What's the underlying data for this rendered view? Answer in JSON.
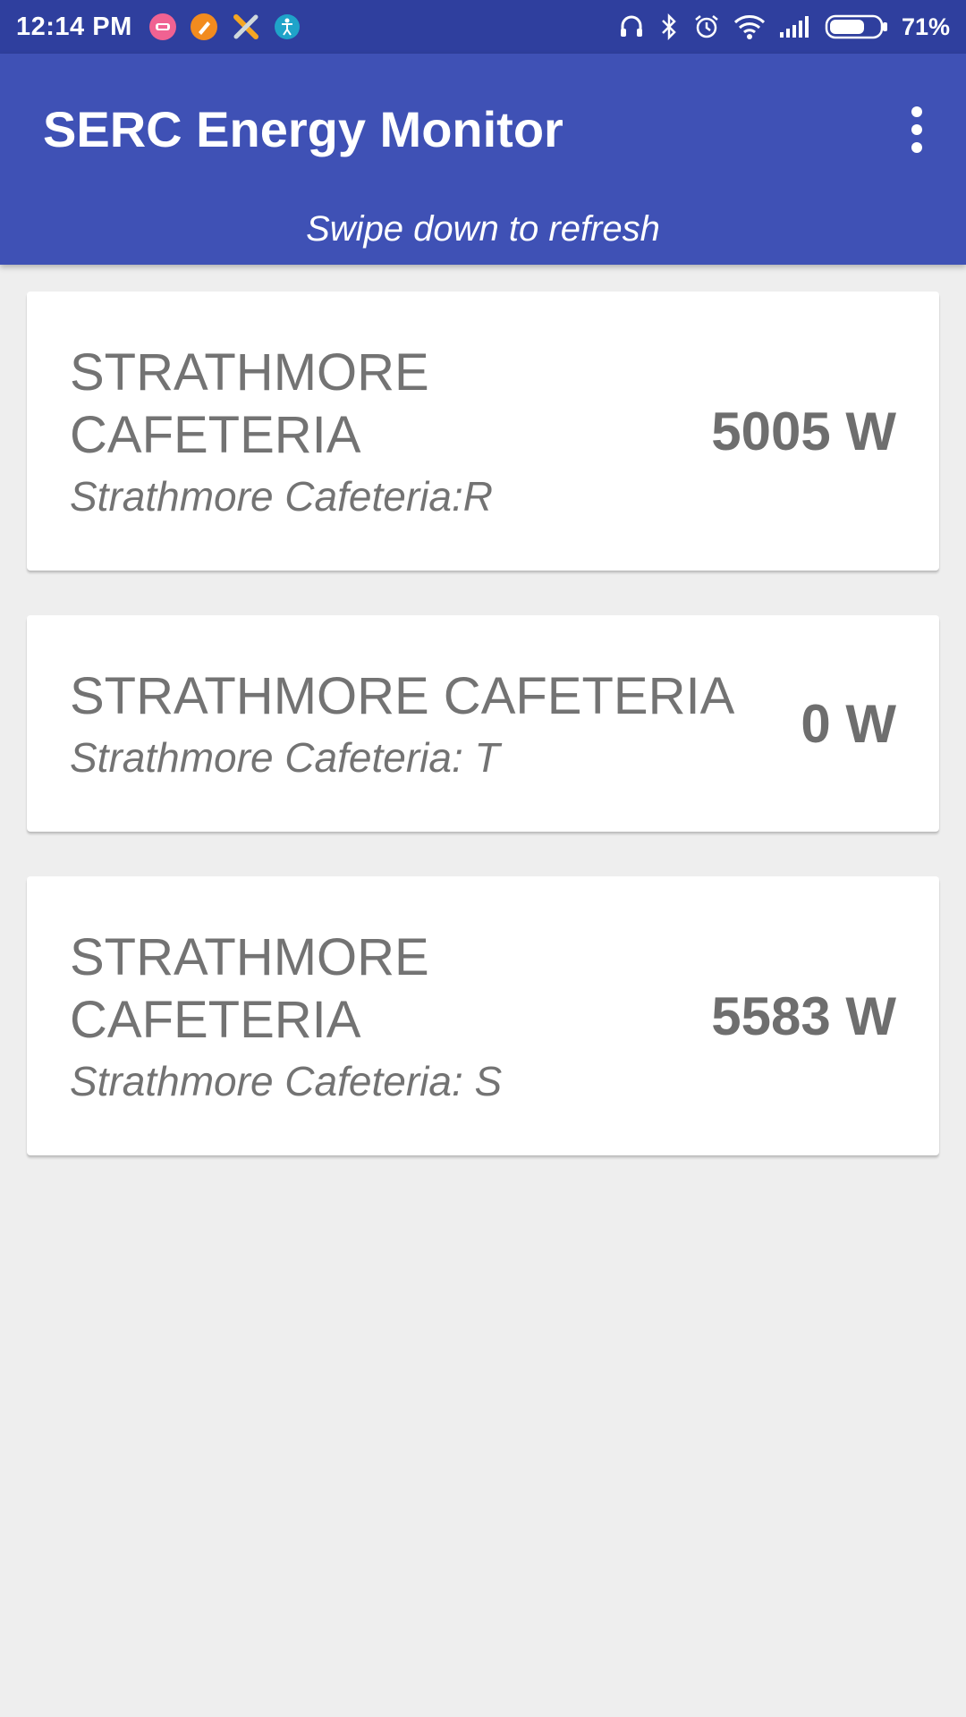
{
  "status_bar": {
    "time": "12:14 PM",
    "battery_percent": "71%",
    "battery_level": 0.71,
    "notification_icons": [
      "pink-app-icon",
      "orange-cleaner-icon",
      "tools-icon",
      "teal-accessibility-icon"
    ],
    "system_icons": [
      "headset-icon",
      "bluetooth-icon",
      "alarm-icon",
      "wifi-icon",
      "signal-icon",
      "battery-icon"
    ]
  },
  "app_bar": {
    "title": "SERC Energy Monitor",
    "hint": "Swipe down to refresh",
    "color": "#3f51b5",
    "status_color": "#2f3f9e"
  },
  "meters": [
    {
      "title": "STRATHMORE CAFETERIA",
      "subtitle": "Strathmore Cafeteria:R",
      "value": "5005 W"
    },
    {
      "title": "STRATHMORE CAFETERIA",
      "subtitle": "Strathmore Cafeteria: T",
      "value": "0 W"
    },
    {
      "title": "STRATHMORE CAFETERIA",
      "subtitle": "Strathmore Cafeteria: S",
      "value": "5583 W"
    }
  ]
}
